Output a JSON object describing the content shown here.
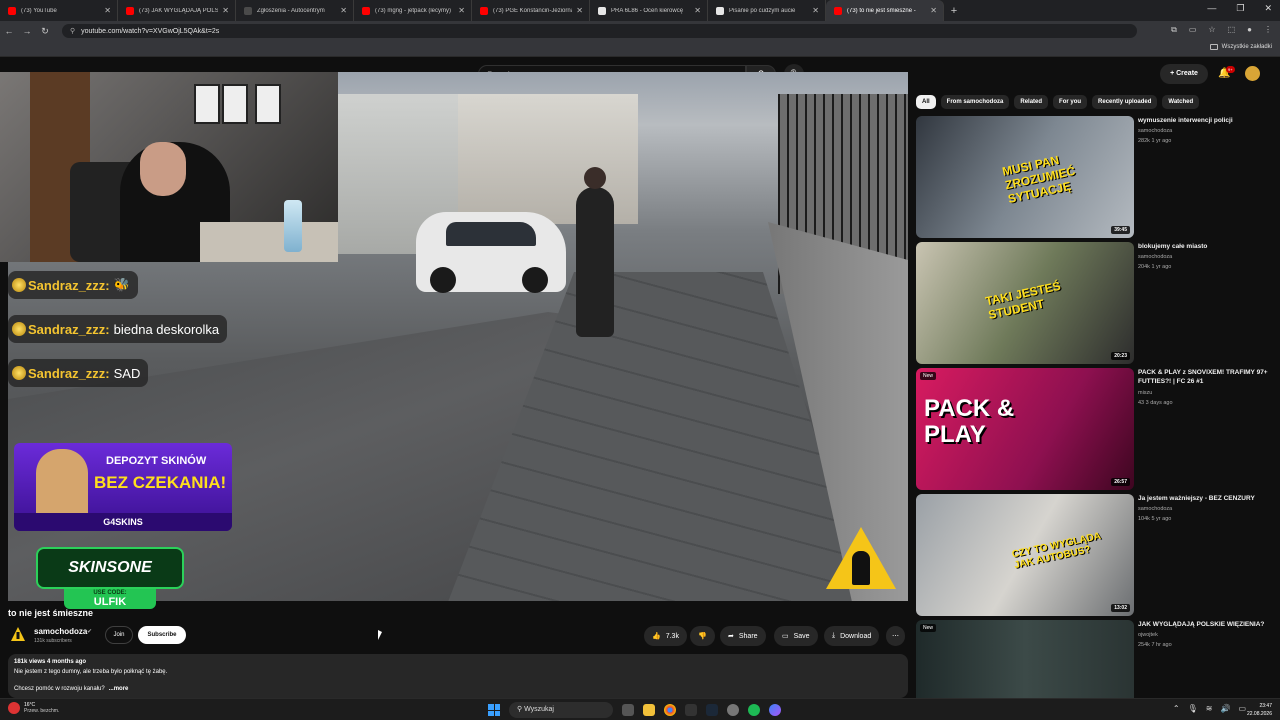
{
  "browser": {
    "tabs": [
      {
        "label": "(73) YouTube",
        "color": "#ff0000"
      },
      {
        "label": "(73) JAK WYGLĄDAJĄ POLSKIE",
        "color": "#ff0000"
      },
      {
        "label": "Zgłoszenia - Autocentrym",
        "color": "#4a4a4a"
      },
      {
        "label": "(73) mgng - jetpack (lecymy)",
        "color": "#ff0000"
      },
      {
        "label": "(73) PGE Konstancin-Jeziorna",
        "color": "#ff0000"
      },
      {
        "label": "PRA 6L86 - Oceń kierowcę",
        "color": "#e6e6e6"
      },
      {
        "label": "Pisanie po cudzym aucie",
        "color": "#e6e6e6"
      },
      {
        "label": "(73) to nie jest śmieszne - ",
        "color": "#ff0000"
      }
    ],
    "url": "youtube.com/watch?v=XVGwOjL5QAk&t=2s",
    "bookmarks_label": "Wszystkie zakładki"
  },
  "yt_header": {
    "search_placeholder": "Search",
    "create_label": "Create",
    "notif_count": "9+"
  },
  "overlay": {
    "chat": [
      {
        "user": "Sandraz_zzz:",
        "text": ""
      },
      {
        "user": "Sandraz_zzz:",
        "text": "biedna deskorolka"
      },
      {
        "user": "Sandraz_zzz:",
        "text": "SAD"
      }
    ],
    "promo_line1": "DEPOZYT SKINÓW",
    "promo_line2": "BEZ CZEKANIA!",
    "promo_brand": "G4SKINS",
    "sponsor": "SKINSONE",
    "code_label": "USE CODE:",
    "code_value": "ULFIK"
  },
  "video": {
    "title": "to nie jest śmieszne",
    "channel": "samochodoza",
    "subs": "131k subscribers",
    "join": "Join",
    "subscribe": "Subscribe",
    "likes": "7.3k",
    "share": "Share",
    "save": "Save",
    "download": "Download",
    "views_date": "181k views  4 months ago",
    "desc_line1": "Nie jestem z tego dumny, ale trzeba było połknąć tę żabę.",
    "desc_line2": "Chcesz pomóc w rozwoju kanału?",
    "more": "...more"
  },
  "chips": [
    "All",
    "From samochodoza",
    "Related",
    "For you",
    "Recently uploaded",
    "Watched"
  ],
  "recommendations": [
    {
      "title": "wymuszenie interwencji policji",
      "channel": "samochodoza",
      "meta": "282k  1 yr ago",
      "duration": "39:45",
      "thumb_text": "MUSI PAN ZROZUMIEĆ SYTUACJĘ",
      "new": ""
    },
    {
      "title": "blokujemy całe miasto",
      "channel": "samochodoza",
      "meta": "204k  1 yr ago",
      "duration": "20:23",
      "thumb_text": "TAKI JESTEŚ STUDENT",
      "new": ""
    },
    {
      "title": "PACK & PLAY z SNOVIXEM! TRAFIMY 97+ FUTTIES?! | FC 26 #1",
      "channel": "miszu",
      "meta": "43  3 days ago",
      "duration": "26:57",
      "thumb_text": "PACK & PLAY",
      "new": "New"
    },
    {
      "title": "Ja jestem ważniejszy - BEZ CENZURY",
      "channel": "samochodoza",
      "meta": "104k  5 yr ago",
      "duration": "13:02",
      "thumb_text": "CZY TO WYGLĄDA JAK AUTOBUS?",
      "new": ""
    },
    {
      "title": "JAK WYGLĄDAJĄ POLSKIE WIĘZIENIA?",
      "channel": "ojwojtek",
      "meta": "254k  7 hr ago",
      "duration": "",
      "thumb_text": "",
      "new": "New"
    }
  ],
  "taskbar": {
    "temp": "16°C",
    "weather": "Przew. bezchm.",
    "search": "Wyszukaj",
    "time": "23:47",
    "date": "22.08.2026"
  }
}
